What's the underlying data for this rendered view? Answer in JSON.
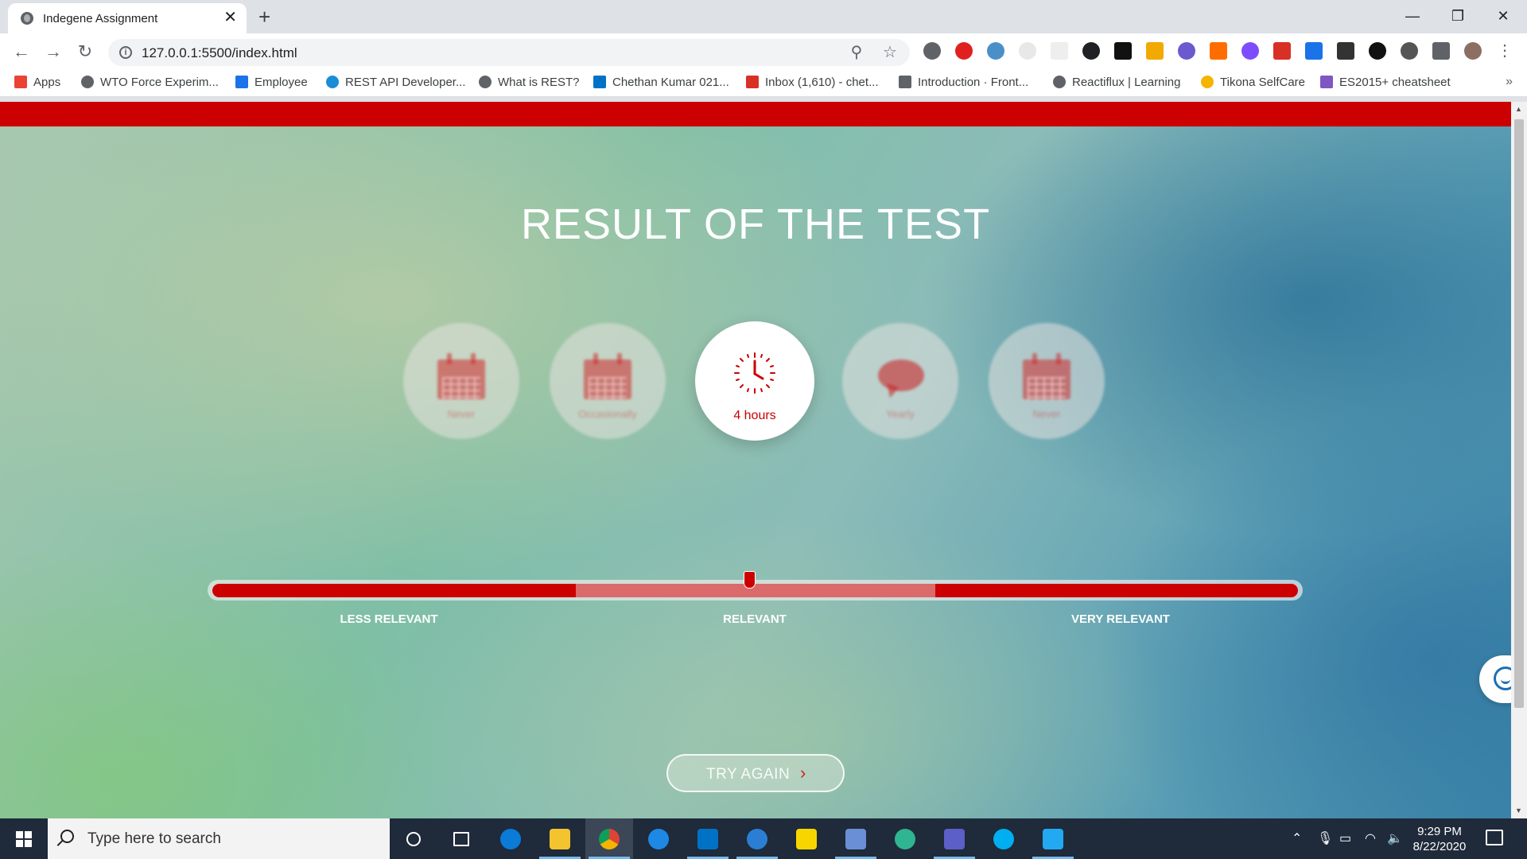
{
  "browser": {
    "tab_title": "Indegene Assignment",
    "tab_close": "✕",
    "new_tab": "+",
    "url": "127.0.0.1:5500/index.html",
    "window_controls": [
      "—",
      "❐",
      "✕"
    ]
  },
  "bookmarks": [
    {
      "label": "Apps",
      "icon_color": "#ea4335"
    },
    {
      "label": "WTO Force Experim...",
      "icon_color": "#5f6368"
    },
    {
      "label": "Employee",
      "icon_color": "#1a73e8"
    },
    {
      "label": "REST API Developer...",
      "icon_color": "#1a8cd8"
    },
    {
      "label": "What is REST?",
      "icon_color": "#5f6368"
    },
    {
      "label": "Chethan Kumar 021...",
      "icon_color": "#0072c6"
    },
    {
      "label": "Inbox (1,610) - chet...",
      "icon_color": "#d93025"
    },
    {
      "label": "Introduction · Front...",
      "icon_color": "#5f6368"
    },
    {
      "label": "Reactiflux | Learning",
      "icon_color": "#5f6368"
    },
    {
      "label": "Tikona SelfCare",
      "icon_color": "#f4b400"
    },
    {
      "label": "ES2015+ cheatsheet",
      "icon_color": "#7e57c2"
    }
  ],
  "bookmarks_more": "»",
  "page": {
    "accent": "#cc0000",
    "title": "RESULT OF THE TEST",
    "options": [
      {
        "label": "Never",
        "icon": "calendar-icon",
        "active": false
      },
      {
        "label": "Occasionally",
        "icon": "calendar-icon",
        "active": false
      },
      {
        "label": "4 hours",
        "icon": "clock-icon",
        "active": true
      },
      {
        "label": "Yearly",
        "icon": "chat-bubble-icon",
        "active": false
      },
      {
        "label": "Never",
        "icon": "calendar-icon",
        "active": false
      }
    ],
    "scale": {
      "labels": [
        "LESS RELEVANT",
        "RELEVANT",
        "VERY RELEVANT"
      ],
      "value_fraction": 0.5
    },
    "try_again_label": "TRY AGAIN",
    "try_again_arrow": "›"
  },
  "taskbar": {
    "search_placeholder": "Type here to search",
    "time": "9:29 PM",
    "date": "8/22/2020"
  }
}
